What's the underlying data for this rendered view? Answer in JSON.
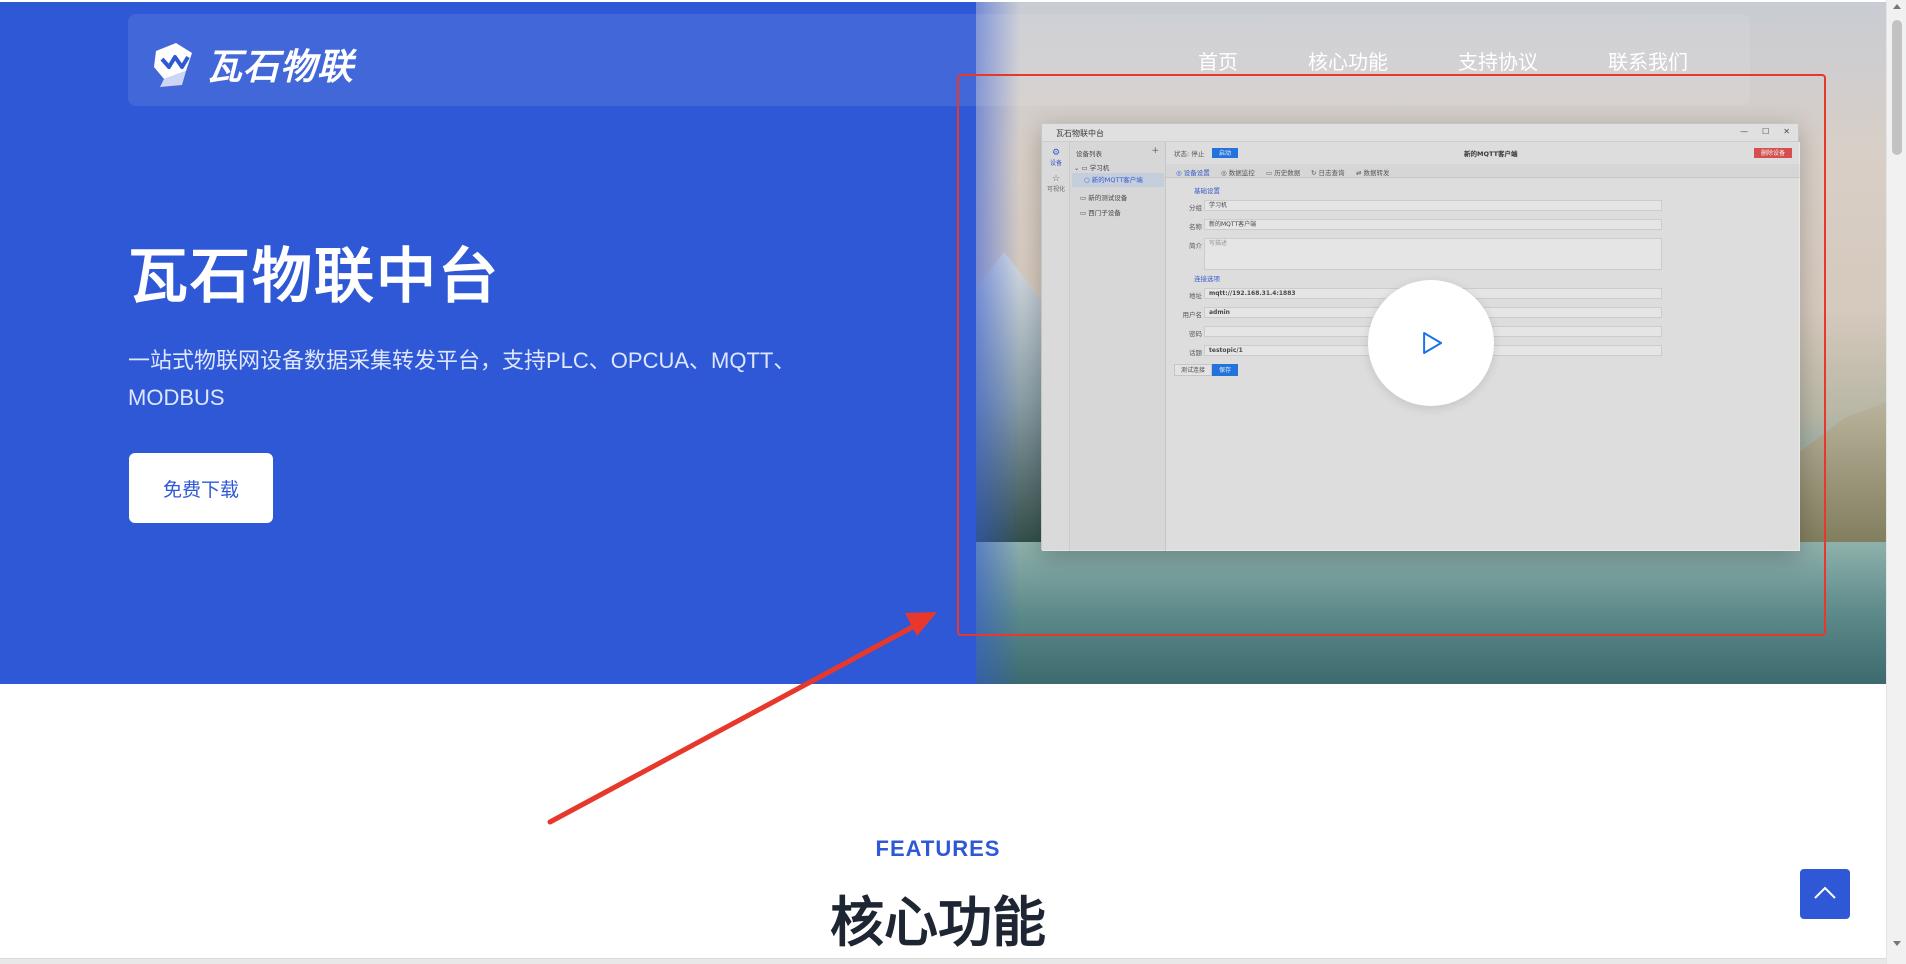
{
  "brand": {
    "name": "瓦石物联"
  },
  "nav": {
    "items": [
      "首页",
      "核心功能",
      "支持协议",
      "联系我们"
    ]
  },
  "hero": {
    "title": "瓦石物联中台",
    "subtitle": "一站式物联网设备数据采集转发平台，支持PLC、OPCUA、MQTT、MODBUS",
    "download_label": "免费下载"
  },
  "preview": {
    "window_title": "瓦石物联中台",
    "rail": [
      "设备",
      "可视化"
    ],
    "tree_header": "设备列表",
    "tree": [
      "学习机",
      "新的MQTT客户端",
      "新的测试设备",
      "西门子设备"
    ],
    "status": "状态: 停止",
    "status_button": "启动",
    "device_title": "新的MQTT客户端",
    "delete_button": "删除设备",
    "tabs": [
      "设备设置",
      "数据监控",
      "历史数据",
      "日志查询",
      "数据转发"
    ],
    "section_basic": "基础设置",
    "fields": [
      {
        "label": "分组",
        "value": "学习机"
      },
      {
        "label": "名称",
        "value": "新的MQTT客户端"
      },
      {
        "label": "简介",
        "value": "写描述"
      }
    ],
    "section_conn": "连接选项",
    "conn_fields": [
      {
        "label": "地址",
        "value": "mqtt://192.168.31.4:1883"
      },
      {
        "label": "用户名",
        "value": "admin"
      },
      {
        "label": "密码",
        "value": ""
      },
      {
        "label": "话题",
        "value": "testopic/1"
      }
    ],
    "test_button": "测试连接",
    "save_button": "保存"
  },
  "features": {
    "eyebrow": "FEATURES",
    "title": "核心功能"
  },
  "colors": {
    "brand": "#2f58d6",
    "annotation": "#e8382b",
    "white": "#ffffff"
  }
}
